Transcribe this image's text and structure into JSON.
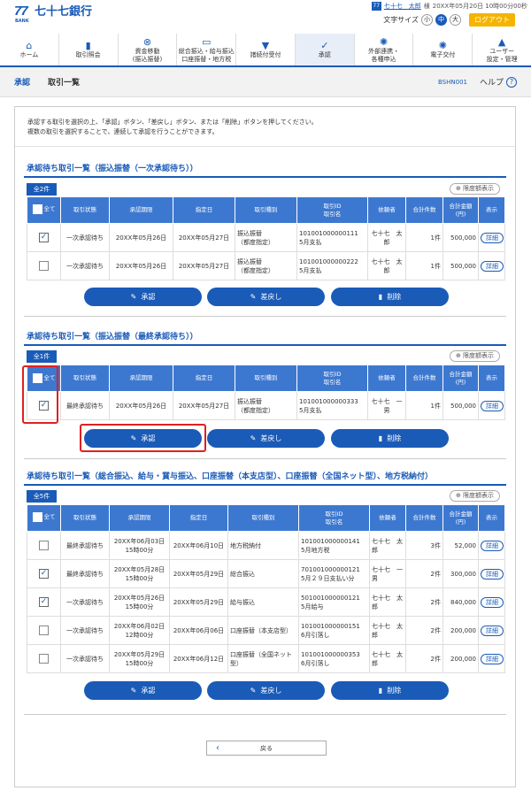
{
  "header": {
    "logo_mark": "77",
    "logo_bank": "BANK",
    "bank_name": "七十七銀行",
    "user_icon": "77",
    "user_name": "七十七　太郎",
    "user_suffix": "様",
    "last_login": "20XX年05月20日 10時00分00秒",
    "font_size_label": "文字サイズ",
    "font_sizes": [
      "小",
      "中",
      "大"
    ],
    "logout": "ログアウト"
  },
  "nav": [
    {
      "icon": "home-icon",
      "glyph": "⌂",
      "l1": "ホーム",
      "l2": ""
    },
    {
      "icon": "document-icon",
      "glyph": "▮",
      "l1": "取引照会",
      "l2": ""
    },
    {
      "icon": "transfer-icon",
      "glyph": "⊗",
      "l1": "資金移動",
      "l2": "(振込振替)"
    },
    {
      "icon": "card-icon",
      "glyph": "▭",
      "l1": "総合振込・給与振込",
      "l2": "口座振替・地方税"
    },
    {
      "icon": "receipt-icon",
      "glyph": "▼",
      "l1": "諸続付受付",
      "l2": ""
    },
    {
      "icon": "approve-icon",
      "glyph": "✓",
      "l1": "承認",
      "l2": ""
    },
    {
      "icon": "link-icon",
      "glyph": "✺",
      "l1": "外部連携・",
      "l2": "各種申込"
    },
    {
      "icon": "gear-icon",
      "glyph": "✺",
      "l1": "電子交付",
      "l2": ""
    },
    {
      "icon": "user-settings-icon",
      "glyph": "▲",
      "l1": "ユーザー",
      "l2": "設定・管理"
    }
  ],
  "breadcrumb": {
    "section": "承認",
    "page": "取引一覧",
    "screen_id": "BSHN001",
    "help": "ヘルプ"
  },
  "intro": [
    "承認する取引を選択の上、「承認」ボタン、「差戻し」ボタン、または「削除」ボタンを押してください。",
    "複数の取引を選択することで、連続して承認を行うことができます。"
  ],
  "sec1": {
    "title": "承認待ち取引一覧（振込振替（一次承認待ち））",
    "count": "全2件",
    "limit": "限度額表示",
    "headers": {
      "all": "全て",
      "status": "取引状態",
      "deadline": "承認期限",
      "date": "指定日",
      "type": "取引種別",
      "id1": "取引ID",
      "id2": "取引名",
      "requester": "依頼者",
      "count1": "合計件数",
      "amount1": "合計金額",
      "amount2": "(円)",
      "view": "表示"
    },
    "rows": [
      {
        "checked": true,
        "status": "一次承認待ち",
        "deadline": "20XX年05月26日",
        "date": "20XX年05月27日",
        "type1": "振込振替",
        "type2": "（都度指定）",
        "id1": "101001000000111",
        "id2": "5月支払",
        "requester": "七十七　太郎",
        "count": "1件",
        "amount": "500,000",
        "detail": "詳細"
      },
      {
        "checked": false,
        "status": "一次承認待ち",
        "deadline": "20XX年05月26日",
        "date": "20XX年05月27日",
        "type1": "振込振替",
        "type2": "（都度指定）",
        "id1": "101001000000222",
        "id2": "5月支払",
        "requester": "七十七　太郎",
        "count": "1件",
        "amount": "500,000",
        "detail": "詳細"
      }
    ]
  },
  "sec2": {
    "title": "承認待ち取引一覧（振込振替（最終承認待ち））",
    "count": "全1件",
    "limit": "限度額表示",
    "rows": [
      {
        "checked": true,
        "status": "最終承認待ち",
        "deadline": "20XX年05月26日",
        "date": "20XX年05月27日",
        "type1": "振込振替",
        "type2": "（都度指定）",
        "id1": "101001000000333",
        "id2": "5月支払",
        "requester": "七十七　一男",
        "count": "1件",
        "amount": "500,000",
        "detail": "詳細"
      }
    ]
  },
  "sec3": {
    "title": "承認待ち取引一覧（総合振込、給与・賞与振込、口座振替（本支店型）、口座振替（全国ネット型）、地方税納付）",
    "count": "全5件",
    "limit": "限度額表示",
    "rows": [
      {
        "checked": false,
        "status": "最終承認待ち",
        "d1": "20XX年06月03日",
        "d2": "15時00分",
        "date": "20XX年06月10日",
        "type1": "地方税納付",
        "type2": "",
        "id1": "101001000000141",
        "id2": "5月地方税",
        "r1": "七十七　太",
        "r2": "郎",
        "count": "3件",
        "amount": "52,000",
        "detail": "詳細"
      },
      {
        "checked": true,
        "status": "最終承認待ち",
        "d1": "20XX年05月28日",
        "d2": "15時00分",
        "date": "20XX年05月29日",
        "type1": "総合振込",
        "type2": "",
        "id1": "701001000000121",
        "id2": "5月２９日支払い分",
        "r1": "七十七　一",
        "r2": "男",
        "count": "2件",
        "amount": "300,000",
        "detail": "詳細"
      },
      {
        "checked": true,
        "status": "一次承認待ち",
        "d1": "20XX年05月26日",
        "d2": "15時00分",
        "date": "20XX年05月29日",
        "type1": "給与振込",
        "type2": "",
        "id1": "501001000000121",
        "id2": "5月給与",
        "r1": "七十七　太",
        "r2": "郎",
        "count": "2件",
        "amount": "840,000",
        "detail": "詳細"
      },
      {
        "checked": false,
        "status": "一次承認待ち",
        "d1": "20XX年06月02日",
        "d2": "12時00分",
        "date": "20XX年06月06日",
        "type1": "口座振替（本支店型）",
        "type2": "",
        "id1": "101001000000151",
        "id2": "6月引落し",
        "r1": "七十七　太",
        "r2": "郎",
        "count": "2件",
        "amount": "200,000",
        "detail": "詳細"
      },
      {
        "checked": false,
        "status": "一次承認待ち",
        "d1": "20XX年05月29日",
        "d2": "15時00分",
        "date": "20XX年06月12日",
        "type1": "口座振替（全国ネット",
        "type2": "型）",
        "id1": "101001000000353",
        "id2": "6月引落し",
        "r1": "七十七　太",
        "r2": "郎",
        "count": "2件",
        "amount": "200,000",
        "detail": "詳細"
      }
    ]
  },
  "buttons": {
    "approve": "承認",
    "return": "差戻し",
    "delete": "削除",
    "back": "戻る"
  },
  "colors": {
    "brand": "#1a5bb8",
    "header_cell": "#3d78d0",
    "logout": "#f4b400",
    "highlight": "#e02020"
  }
}
